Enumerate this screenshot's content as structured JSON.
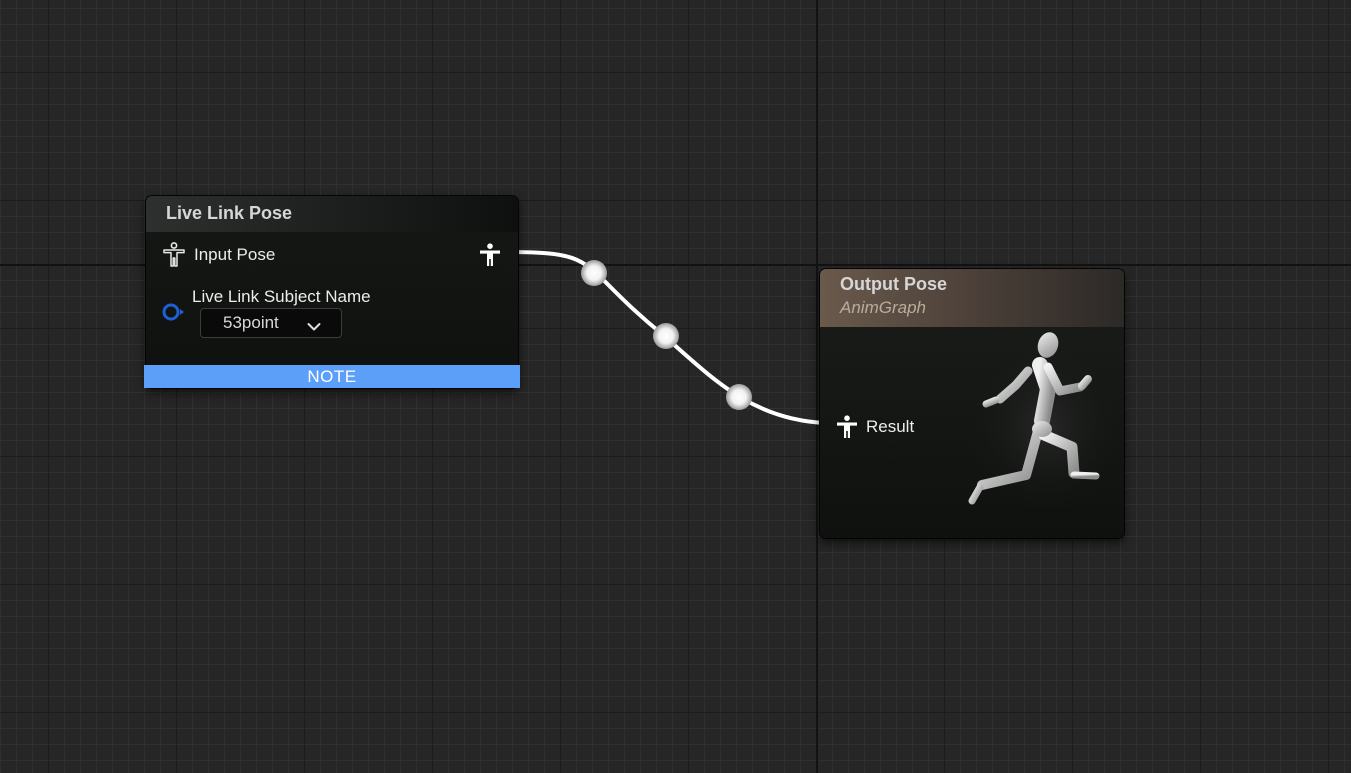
{
  "graph": {
    "nodes": {
      "live_link_pose": {
        "title": "Live Link Pose",
        "input_pin_label": "Input Pose",
        "subject_label": "Live Link Subject Name",
        "subject_value": "53point",
        "note_label": "NOTE",
        "note_color": "#5b9ff8"
      },
      "output_pose": {
        "title": "Output Pose",
        "subtitle": "AnimGraph",
        "result_pin_label": "Result",
        "header_color": "#6a5a4c"
      }
    },
    "icons": {
      "pose_pin": "pose-pin-icon",
      "name_pin": "name-pin-icon",
      "dropdown": "chevron-down-icon",
      "mannequin": "running-mannequin-icon"
    },
    "colors": {
      "canvas": "#262626",
      "wire": "#ffffff",
      "name_pin": "#1d5fd6"
    }
  }
}
